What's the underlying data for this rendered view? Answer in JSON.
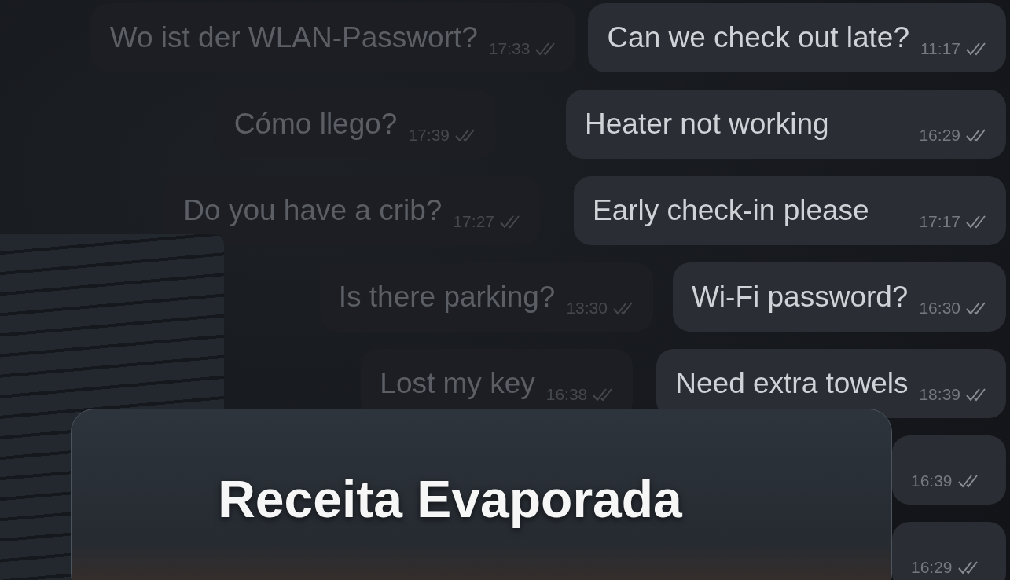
{
  "chat_rows": [
    {
      "left": {
        "text": "Wo ist der WLAN-Passwort?",
        "time": "17:33"
      },
      "right": {
        "text": "Can we check out late?",
        "time": "11:17"
      }
    },
    {
      "left": {
        "text": "Cómo llego?",
        "time": "17:39"
      },
      "right": {
        "text": "Heater not working",
        "time": "16:29"
      }
    },
    {
      "left": {
        "text": "Do you have a crib?",
        "time": "17:27"
      },
      "right": {
        "text": "Early check-in please",
        "time": "17:17"
      }
    },
    {
      "left": {
        "text": "Is there parking?",
        "time": "13:30"
      },
      "right": {
        "text": "Wi-Fi password?",
        "time": "16:30"
      }
    },
    {
      "left": {
        "text": "Lost my key",
        "time": "16:38"
      },
      "right": {
        "text": "Need extra towels",
        "time": "18:39"
      }
    },
    {
      "right": {
        "time": "16:39"
      }
    },
    {
      "right": {
        "time": "16:29"
      }
    }
  ],
  "card": {
    "title": "Receita Evaporada"
  }
}
